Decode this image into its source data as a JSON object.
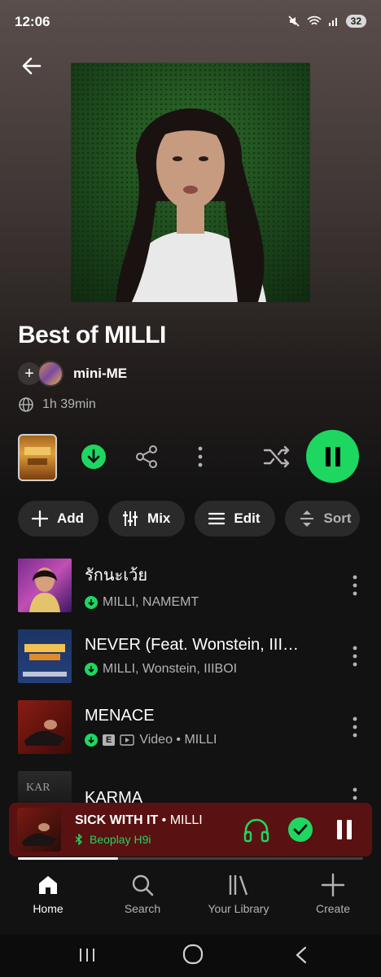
{
  "status": {
    "time": "12:06",
    "battery": "32"
  },
  "playlist": {
    "title": "Best of MILLI",
    "owner": "mini-ME",
    "duration": "1h 39min"
  },
  "chips": [
    {
      "label": "Add",
      "icon": "plus-icon"
    },
    {
      "label": "Mix",
      "icon": "sliders-icon"
    },
    {
      "label": "Edit",
      "icon": "lines-icon"
    },
    {
      "label": "Sort",
      "icon": "sort-icon"
    }
  ],
  "tracks": [
    {
      "title": "รักนะเว้ย",
      "subtitle": "MILLI, NAMEMT",
      "downloaded": true,
      "explicit": false,
      "video": false
    },
    {
      "title": "NEVER (Feat. Wonstein, IIIBOI)",
      "subtitle": "MILLI, Wonstein, IIIBOI",
      "downloaded": true,
      "explicit": false,
      "video": false
    },
    {
      "title": "MENACE",
      "subtitle": "Video • MILLI",
      "downloaded": true,
      "explicit": true,
      "video": true
    },
    {
      "title": "KARMA",
      "subtitle": "",
      "downloaded": true,
      "explicit": false,
      "video": false
    }
  ],
  "now_playing": {
    "title": "SICK WITH IT",
    "separator": " • ",
    "artist": "MILLI",
    "device": "Beoplay H9i",
    "progress": 0.29
  },
  "nav": [
    {
      "label": "Home",
      "icon": "home-icon",
      "active": true
    },
    {
      "label": "Search",
      "icon": "search-icon",
      "active": false
    },
    {
      "label": "Your Library",
      "icon": "library-icon",
      "active": false
    },
    {
      "label": "Create",
      "icon": "plus-icon",
      "active": false
    }
  ],
  "colors": {
    "accent": "#1ed760",
    "background": "#121212",
    "mini_player": "#5a1111"
  }
}
